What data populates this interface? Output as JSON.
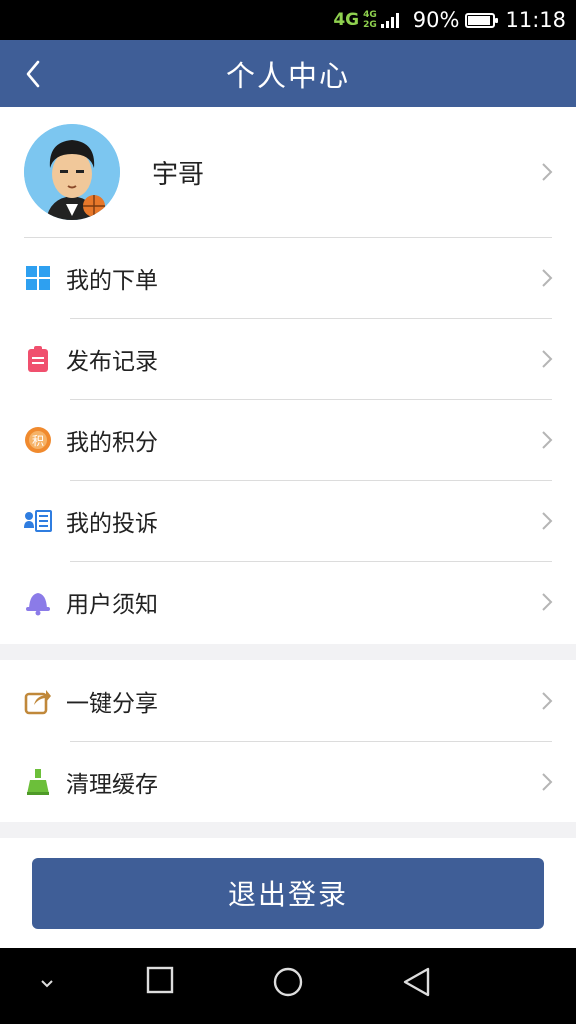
{
  "status_bar": {
    "network": "4G",
    "network_small_top": "4G",
    "network_small_bottom": "2G",
    "battery_text": "90%",
    "battery_level": 0.9,
    "time": "11:18"
  },
  "header": {
    "title": "个人中心",
    "back_icon": "back-arrow-icon",
    "bg_color": "#3f5e97"
  },
  "profile": {
    "name": "宇哥",
    "avatar_icon": "cartoon-avatar"
  },
  "menu_group_1": [
    {
      "label": "我的下单",
      "icon": "grid-windows-icon",
      "color": "#2ea0f0"
    },
    {
      "label": "发布记录",
      "icon": "clipboard-icon",
      "color": "#f0506e"
    },
    {
      "label": "我的积分",
      "icon": "points-coin-icon",
      "color": "#f08a2e"
    },
    {
      "label": "我的投诉",
      "icon": "contact-list-icon",
      "color": "#2f7de0"
    },
    {
      "label": "用户须知",
      "icon": "bell-icon",
      "color": "#8b7be8"
    }
  ],
  "menu_group_2": [
    {
      "label": "一键分享",
      "icon": "share-icon",
      "color": "#c0883a"
    },
    {
      "label": "清理缓存",
      "icon": "broom-icon",
      "color": "#6cbf3a"
    }
  ],
  "logout": {
    "label": "退出登录"
  },
  "system_nav": {
    "icons": [
      "chevron-down-icon",
      "square-recent-icon",
      "circle-home-icon",
      "triangle-back-icon"
    ]
  }
}
